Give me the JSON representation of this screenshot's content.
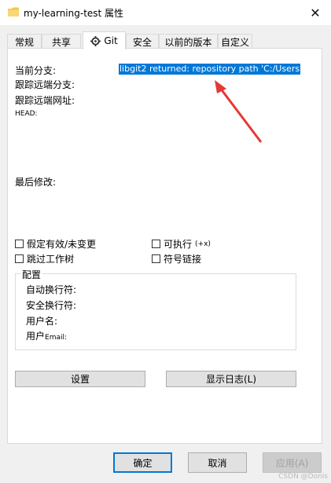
{
  "window": {
    "title": "my-learning-test 属性",
    "close_glyph": "✕"
  },
  "tabs": [
    {
      "label": "常规"
    },
    {
      "label": "共享"
    },
    {
      "label": "Git",
      "active": true
    },
    {
      "label": "安全"
    },
    {
      "label": "以前的版本"
    },
    {
      "label": "自定义"
    }
  ],
  "git": {
    "current_branch_label": "当前分支:",
    "current_branch_value": "libgit2 returned: repository path 'C:/Users",
    "tracking_branch_label": "跟踪远端分支:",
    "tracking_url_label": "跟踪远端网址:",
    "head_label": "HEAD:",
    "last_modified_label": "最后修改:"
  },
  "checkboxes": {
    "assume_unchanged": "假定有效/未变更",
    "skip_worktree": "跳过工作树",
    "executable": "可执行",
    "executable_suffix": "(+x)",
    "symlink": "符号链接"
  },
  "config": {
    "title": "配置",
    "autocrlf": "自动换行符:",
    "safecrlf": "安全换行符:",
    "username": "用户名:",
    "email_prefix": "用户",
    "email_suffix": "Email:"
  },
  "buttons": {
    "settings": "设置",
    "show_log": "显示日志(L)",
    "ok": "确定",
    "cancel": "取消",
    "apply": "应用(A)"
  },
  "watermark": "CSDN @Donis",
  "colors": {
    "selection": "#0078d7",
    "arrow": "#e53935"
  }
}
